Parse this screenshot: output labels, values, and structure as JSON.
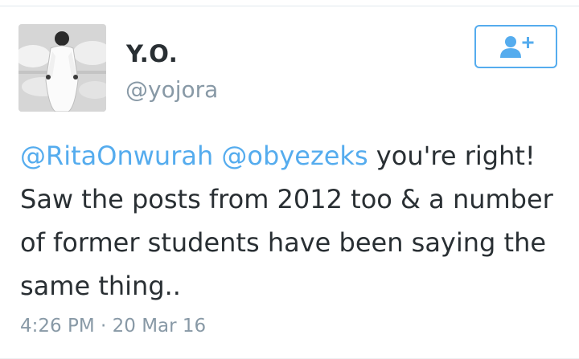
{
  "tweet": {
    "author": {
      "display_name": "Y.O.",
      "handle": "@yojora",
      "avatar_icon": "profile-photo"
    },
    "follow_button": {
      "icon": "follow-user-plus-icon",
      "color": "#55acee"
    },
    "text": {
      "mention_1": "@RitaOnwurah",
      "mention_2": "@obyezeks",
      "body": " you're right! Saw the posts from 2012 too & a number of former students have been saying the same thing.."
    },
    "time": "4:26 PM",
    "separator": "·",
    "date": "20 Mar 16"
  },
  "colors": {
    "link": "#55acee",
    "text": "#292f33",
    "muted": "#8899a6"
  }
}
